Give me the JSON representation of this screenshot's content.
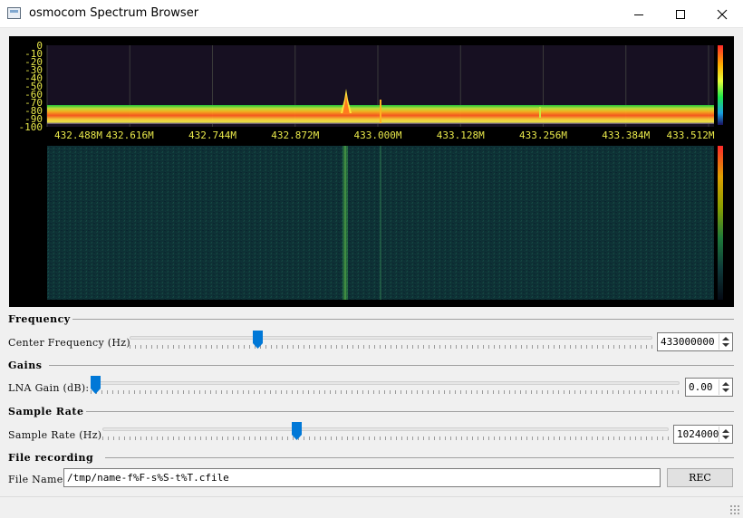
{
  "window": {
    "title": "osmocom Spectrum Browser"
  },
  "spectrum": {
    "y_ticks": [
      "0",
      "-10",
      "-20",
      "-30",
      "-40",
      "-50",
      "-60",
      "-70",
      "-80",
      "-90",
      "-100"
    ],
    "x_ticks": [
      "432.488M",
      "432.616M",
      "432.744M",
      "432.872M",
      "433.000M",
      "433.128M",
      "433.256M",
      "433.384M",
      "433.512M"
    ],
    "colors": {
      "background": "#000000",
      "plot_bg": "#171022",
      "grid": "#3a3a3a",
      "tick_text": "#e8e84a",
      "waterfall_bg": "#0d2f33"
    }
  },
  "frequency": {
    "section_title": "Frequency",
    "label": "Center Frequency (Hz)",
    "value": "433000000",
    "slider_fraction": 0.24
  },
  "gains": {
    "section_title": "Gains",
    "label": "LNA Gain (dB):",
    "value": "0.00",
    "slider_fraction": 0.0
  },
  "sample_rate": {
    "section_title": "Sample Rate",
    "label": "Sample Rate (Hz)",
    "value": "1024000",
    "slider_fraction": 0.34
  },
  "file_recording": {
    "section_title": "File recording",
    "label": "File Name",
    "value": "/tmp/name-f%F-s%S-t%T.cfile",
    "rec_label": "REC"
  }
}
